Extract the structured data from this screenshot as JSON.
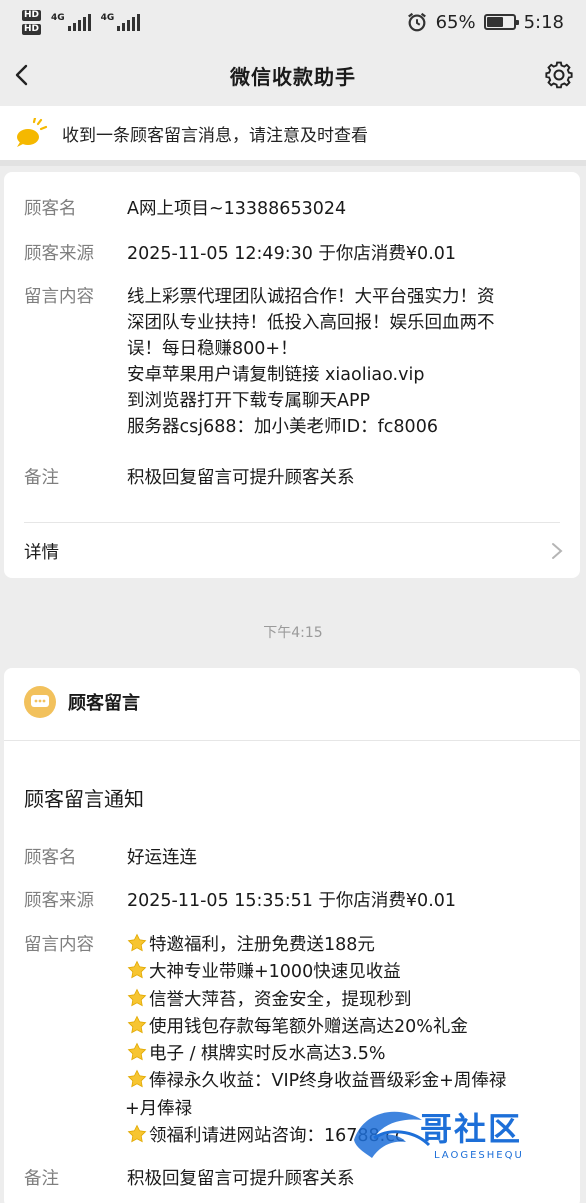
{
  "status_bar": {
    "hd1": "HD",
    "hd2": "HD",
    "net1": "4G",
    "net2": "4G",
    "battery_percent": "65%",
    "battery_level": 0.65,
    "time": "5:18"
  },
  "nav": {
    "title": "微信收款助手",
    "back_icon": "chevron-left-icon",
    "settings_icon": "gear-icon"
  },
  "notice": {
    "text": "收到一条顾客留言消息，请注意及时查看",
    "icon": "bell-icon"
  },
  "card1": {
    "rows": [
      {
        "label": "顾客名",
        "value": "A网上项目~13388653024"
      },
      {
        "label": "顾客来源",
        "value": "2025-11-05 12:49:30 于你店消费¥0.01"
      },
      {
        "label": "留言内容",
        "lines": [
          "线上彩票代理团队诚招合作！大平台强实力！资",
          "深团队专业扶持！低投入高回报！娱乐回血两不",
          "误！每日稳赚800+！",
          "安卓苹果用户请复制链接 xiaoliao.vip",
          "到浏览器打开下载专属聊天APP",
          "服务器csj688：加小美老师ID：fc8006"
        ]
      },
      {
        "label": "备注",
        "value": "积极回复留言可提升顾客关系"
      }
    ],
    "details_label": "详情"
  },
  "time_separator": "下午4:15",
  "card2": {
    "header_title": "顾客留言",
    "notify_title": "顾客留言通知",
    "rows": [
      {
        "label": "顾客名",
        "value": "好运连连"
      },
      {
        "label": "顾客来源",
        "value": "2025-11-05 15:35:51 于你店消费¥0.01"
      },
      {
        "label": "留言内容",
        "lines": [
          "特邀福利，注册免费送188元",
          "大神专业带赚+1000快速见收益",
          "信誉大萍苔，资金安全，提现秒到",
          "使用钱包存款每笔额外赠送高达20%礼金",
          "电子 / 棋牌实时反水高达3.5%",
          "俸禄永久收益：VIP终身收益晋级彩金+周俸禄",
          "+月俸禄",
          "领福利请进网站咨询：16788.cc"
        ]
      },
      {
        "label": "备注",
        "value": "积极回复留言可提升顾客关系"
      }
    ]
  },
  "watermark": {
    "text": "哥社区",
    "sub": "LAOGESHEQU"
  }
}
